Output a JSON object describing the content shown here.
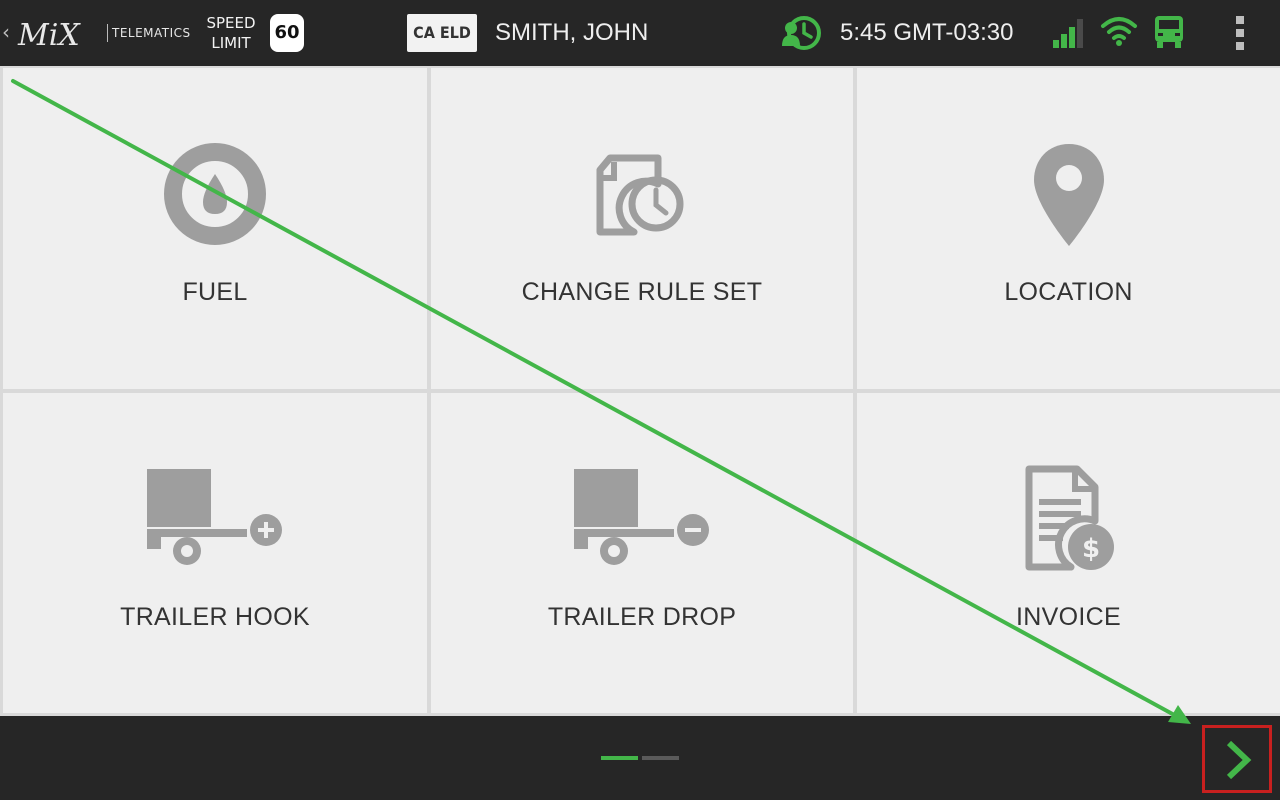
{
  "header": {
    "back_icon": "chevron-left-icon",
    "logo_text": "MiX",
    "telematics_label": "TELEMATICS",
    "speed_limit_label_line1": "SPEED",
    "speed_limit_label_line2": "LIMIT",
    "speed_limit_value": "60",
    "eld_badge": "CA ELD",
    "driver_name": "SMITH, JOHN",
    "time": "5:45 GMT-03:30",
    "icons": [
      "hos-clock-icon",
      "cell-signal-icon",
      "wifi-icon",
      "truck-icon",
      "more-vertical-icon"
    ]
  },
  "tiles": [
    {
      "label": "FUEL",
      "icon": "fuel-drop-icon"
    },
    {
      "label": "CHANGE RULE SET",
      "icon": "document-clock-icon"
    },
    {
      "label": "LOCATION",
      "icon": "map-pin-icon"
    },
    {
      "label": "TRAILER HOOK",
      "icon": "trailer-add-icon"
    },
    {
      "label": "TRAILER DROP",
      "icon": "trailer-remove-icon"
    },
    {
      "label": "INVOICE",
      "icon": "invoice-dollar-icon"
    }
  ],
  "pager": {
    "pages": 2,
    "current": 1
  },
  "next_button_icon": "chevron-right-icon",
  "colors": {
    "accent_green": "#43b649",
    "bar_bg": "#262626",
    "tile_bg": "#efefef",
    "icon_gray": "#9e9e9e",
    "highlight_red": "#c8201f"
  }
}
